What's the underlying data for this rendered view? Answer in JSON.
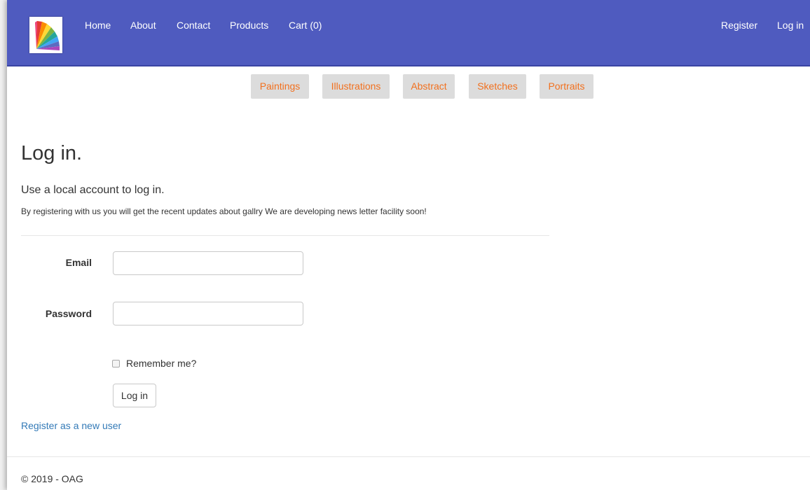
{
  "navbar": {
    "background": "#4f5bbf",
    "logo_icon": "color-swatch-fan-icon",
    "links": {
      "home": "Home",
      "about": "About",
      "contact": "Contact",
      "products": "Products",
      "cart": "Cart (0)"
    },
    "right_links": {
      "register": "Register",
      "login": "Log in"
    }
  },
  "categories": {
    "text_color": "#f2701e",
    "items": [
      "Paintings",
      "Illustrations",
      "Abstract",
      "Sketches",
      "Portraits"
    ]
  },
  "main": {
    "title": "Log in.",
    "subtitle": "Use a local account to log in.",
    "info": "By registering with us you will get the recent updates about gallry We are developing news letter facility soon!"
  },
  "form": {
    "email_label": "Email",
    "email_value": "",
    "password_label": "Password",
    "password_value": "",
    "remember_label": "Remember me?",
    "remember_checked": false,
    "submit_label": "Log in"
  },
  "register_link": "Register as a new user",
  "footer": "© 2019 - OAG"
}
